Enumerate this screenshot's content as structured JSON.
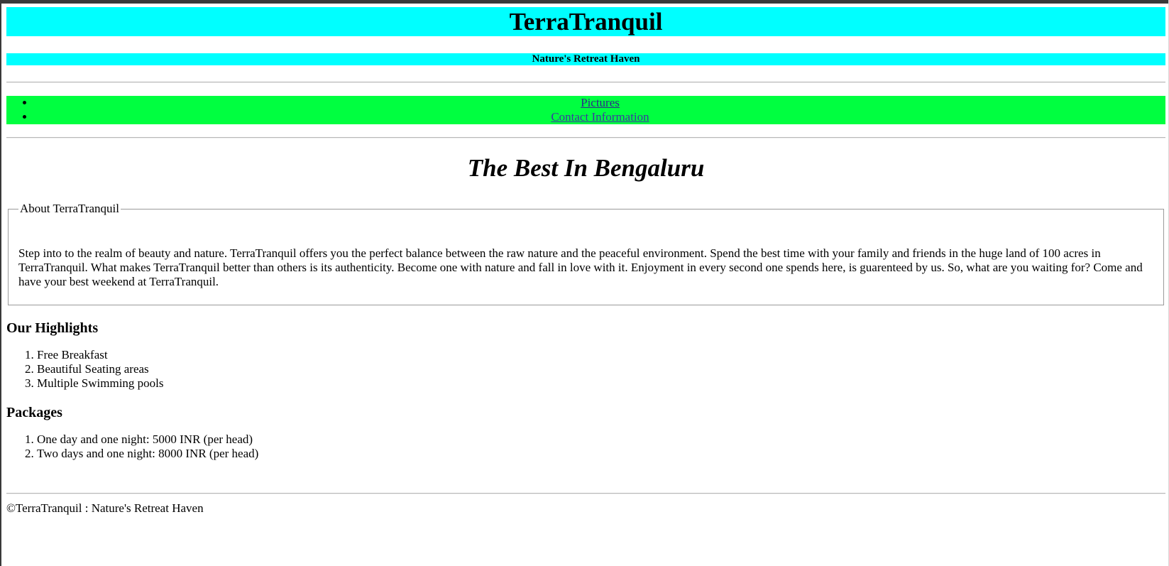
{
  "header": {
    "title": "TerraTranquil",
    "subtitle": "Nature's Retreat Haven"
  },
  "nav": {
    "items": [
      {
        "label": "Pictures"
      },
      {
        "label": "Contact Information"
      }
    ]
  },
  "main": {
    "headline": "The Best In Bengaluru",
    "about": {
      "legend": "About TerraTranquil",
      "text": "Step into to the realm of beauty and nature. TerraTranquil offers you the perfect balance between the raw nature and the peaceful environment. Spend the best time with your family and friends in the huge land of 100 acres in TerraTranquil. What makes TerraTranquil better than others is its authenticity. Become one with nature and fall in love with it. Enjoyment in every second one spends here, is guarenteed by us. So, what are you waiting for? Come and have your best weekend at TerraTranquil."
    },
    "highlights": {
      "title": "Our Highlights",
      "items": [
        "Free Breakfast",
        "Beautiful Seating areas",
        "Multiple Swimming pools"
      ]
    },
    "packages": {
      "title": "Packages",
      "items": [
        "One day and one night: 5000 INR (per head)",
        "Two days and one night: 8000 INR (per head)"
      ]
    }
  },
  "footer": {
    "text": "©TerraTranquil : Nature's Retreat Haven"
  },
  "colors": {
    "header_bg": "#00ffff",
    "nav_bg": "#00ff40",
    "link": "#2b2b8a"
  }
}
